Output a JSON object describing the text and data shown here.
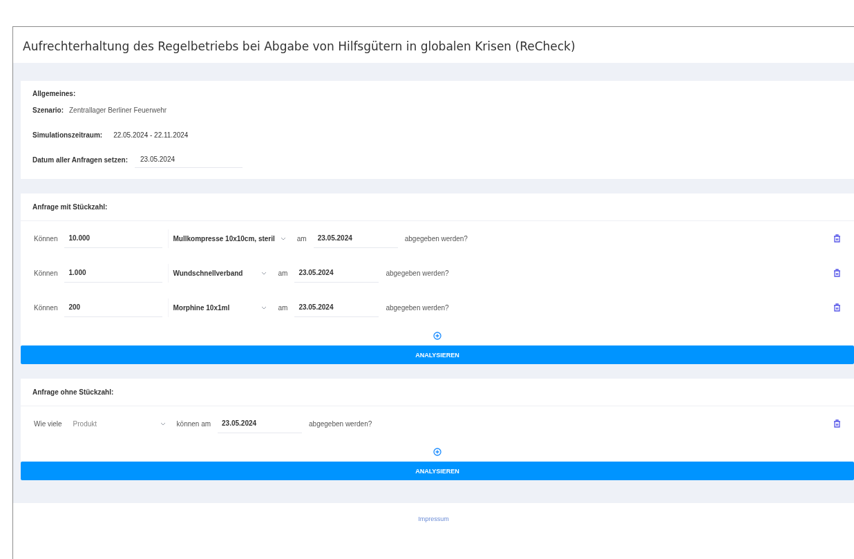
{
  "window": {
    "title": "Aufrechterhaltung des Regelbetriebs bei Abgabe von Hilfsgütern in globalen Krisen (ReCheck)"
  },
  "general": {
    "heading": "Allgemeines:",
    "fields": [
      {
        "kind": "plain",
        "label": "Szenario:",
        "value": "Zentrallager Berliner Feuerwehr"
      },
      {
        "kind": "strong",
        "label": "Simulationszeitraum:",
        "value": "22.05.2024 - 22.11.2024"
      },
      {
        "kind": "input",
        "label": "Datum aller Anfragen setzen:",
        "value": "23.05.2024"
      }
    ]
  },
  "with_quantity": {
    "heading": "Anfrage mit Stückzahl:",
    "rows": [
      {
        "prefix": "Können",
        "quantity": "10.000",
        "product": "Mullkompresse 10x10cm, steril",
        "connector": "am",
        "date": "23.05.2024",
        "suffix": "abgegeben werden?"
      },
      {
        "prefix": "Können",
        "quantity": "1.000",
        "product": "Wundschnellverband",
        "connector": "am",
        "date": "23.05.2024",
        "suffix": "abgegeben werden?"
      },
      {
        "prefix": "Können",
        "quantity": "200",
        "product": "Morphine 10x1ml",
        "connector": "am",
        "date": "23.05.2024",
        "suffix": "abgegeben werden?"
      }
    ],
    "button": "ANALYSIEREN"
  },
  "without_quantity": {
    "heading": "Anfrage ohne Stückzahl:",
    "rows": [
      {
        "prefix": "Wie viele",
        "product_placeholder": "Produkt",
        "connector": "können am",
        "date": "23.05.2024",
        "suffix": "abgegeben werden?"
      }
    ],
    "button": "ANALYSIEREN"
  },
  "footer": {
    "link": "Impressum"
  }
}
